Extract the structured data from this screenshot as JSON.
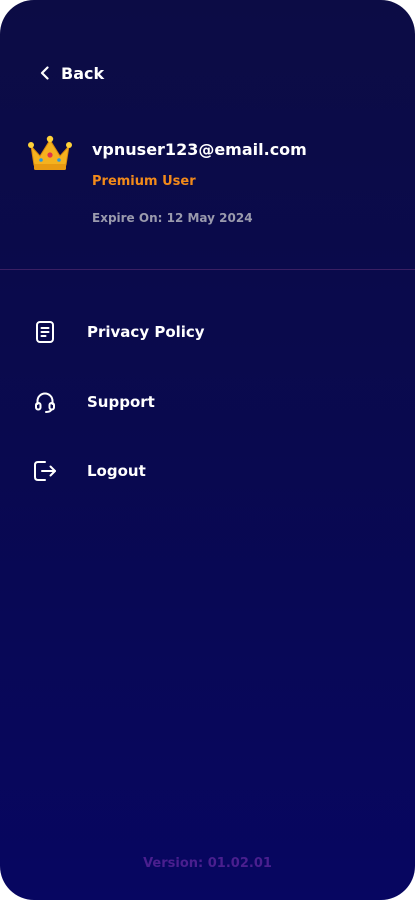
{
  "header": {
    "back_label": "Back",
    "back_icon": "chevron-left-icon"
  },
  "profile": {
    "badge_icon": "crown-icon",
    "email": "vpnuser123@email.com",
    "tier": "Premium User",
    "expire": "Expire On: 12 May 2024"
  },
  "menu": {
    "items": [
      {
        "label": "Privacy Policy",
        "icon": "document-icon"
      },
      {
        "label": "Support",
        "icon": "headset-icon"
      },
      {
        "label": "Logout",
        "icon": "logout-icon"
      }
    ]
  },
  "footer": {
    "version": "Version: 01.02.01"
  },
  "colors": {
    "background_top": "#0c0c45",
    "background_bottom": "#070661",
    "accent_tier": "#f28a1a",
    "version_text": "#4a1f8f"
  }
}
